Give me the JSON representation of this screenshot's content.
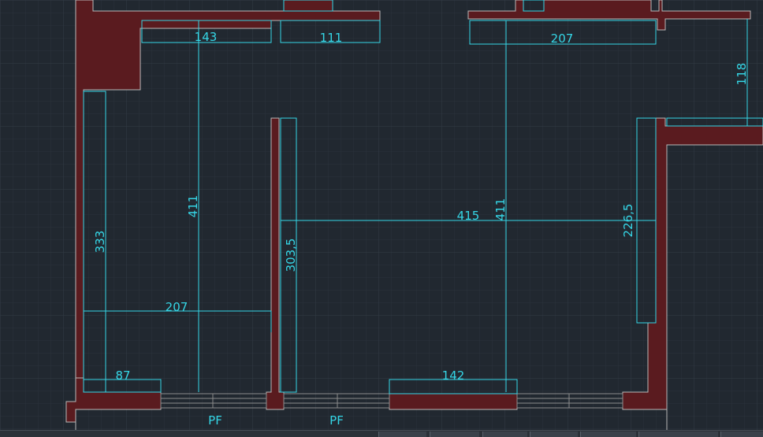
{
  "drawing": {
    "dimensions": {
      "d143": "143",
      "d111": "111",
      "d207_top": "207",
      "d118": "118",
      "d411_left": "411",
      "d333": "333",
      "d207_left": "207",
      "d87": "87",
      "d303_5": "303,5",
      "d415": "415",
      "d411_right": "411",
      "d226_5": "226,5",
      "d142": "142"
    },
    "window_labels": {
      "pf1": "PF",
      "pf2": "PF"
    }
  },
  "colors": {
    "background": "#212830",
    "wall": "#5a1b1f",
    "dimension": "#35d6e6"
  }
}
